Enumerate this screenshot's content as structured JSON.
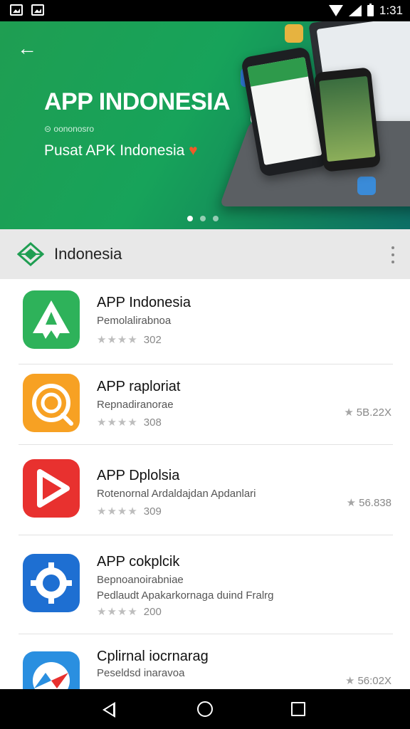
{
  "status_bar": {
    "time": "1:31"
  },
  "hero": {
    "title": "APP INDONESIA",
    "small_text": "⊝ oononosro",
    "subtitle": "Pusat APK Indonesia",
    "heart": "♥",
    "carousel": {
      "pages": 3,
      "active_page": 1
    },
    "colors": {
      "gradient_start": "#1f9e52",
      "gradient_end": "#0d6f66"
    }
  },
  "section": {
    "title": "Indonesia",
    "logo_icon": "green-diamond-logo-icon"
  },
  "apps": [
    {
      "name": "APP Indonesia",
      "desc_lines": [
        "Pemolalirabnoa"
      ],
      "stars": "★★★★",
      "rating_count": "302",
      "size": "",
      "icon_color": "#2eb25a",
      "icon": "green-app-logo-icon"
    },
    {
      "name": "APP raploriat",
      "desc_lines": [
        "Repnadiranorae"
      ],
      "stars": "★★★★",
      "rating_count": "308",
      "size": "5B.22X",
      "icon_color": "#f7a123",
      "icon": "orange-circle-app-icon"
    },
    {
      "name": "APP Dplolsia",
      "desc_lines": [
        "Rotenornal Ardaldajdan Apdanlari"
      ],
      "stars": "★★★★",
      "rating_count": "309",
      "size": "56.838",
      "icon_color": "#e8312f",
      "icon": "red-play-app-icon"
    },
    {
      "name": "APP cokplcik",
      "desc_lines": [
        "Bepnoanoirabniae",
        "Pedlaudt Apakarkornaga duind Fralrg"
      ],
      "stars": "★★★★",
      "rating_count": "200",
      "size": "",
      "icon_color": "#1e6fd2",
      "icon": "blue-gear-app-icon"
    },
    {
      "name": "Cplirnal iocrnarag",
      "desc_lines": [
        "Peseldsd inaravoa"
      ],
      "stars": "★★★★",
      "rating_count": "",
      "size": "56:02X",
      "icon_color": "#2a8fe0",
      "icon": "blue-compass-app-icon"
    }
  ],
  "nav": {
    "back_icon": "triangle-back-icon",
    "home_icon": "circle-home-icon",
    "recent_icon": "square-recents-icon"
  }
}
